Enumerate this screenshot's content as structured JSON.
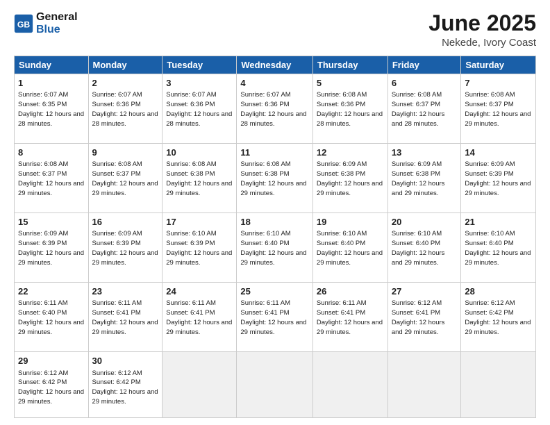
{
  "header": {
    "logo_line1": "General",
    "logo_line2": "Blue",
    "title": "June 2025",
    "subtitle": "Nekede, Ivory Coast"
  },
  "weekdays": [
    "Sunday",
    "Monday",
    "Tuesday",
    "Wednesday",
    "Thursday",
    "Friday",
    "Saturday"
  ],
  "weeks": [
    [
      {
        "day": "1",
        "sunrise": "6:07 AM",
        "sunset": "6:35 PM",
        "daylight": "12 hours and 28 minutes."
      },
      {
        "day": "2",
        "sunrise": "6:07 AM",
        "sunset": "6:36 PM",
        "daylight": "12 hours and 28 minutes."
      },
      {
        "day": "3",
        "sunrise": "6:07 AM",
        "sunset": "6:36 PM",
        "daylight": "12 hours and 28 minutes."
      },
      {
        "day": "4",
        "sunrise": "6:07 AM",
        "sunset": "6:36 PM",
        "daylight": "12 hours and 28 minutes."
      },
      {
        "day": "5",
        "sunrise": "6:08 AM",
        "sunset": "6:36 PM",
        "daylight": "12 hours and 28 minutes."
      },
      {
        "day": "6",
        "sunrise": "6:08 AM",
        "sunset": "6:37 PM",
        "daylight": "12 hours and 28 minutes."
      },
      {
        "day": "7",
        "sunrise": "6:08 AM",
        "sunset": "6:37 PM",
        "daylight": "12 hours and 29 minutes."
      }
    ],
    [
      {
        "day": "8",
        "sunrise": "6:08 AM",
        "sunset": "6:37 PM",
        "daylight": "12 hours and 29 minutes."
      },
      {
        "day": "9",
        "sunrise": "6:08 AM",
        "sunset": "6:37 PM",
        "daylight": "12 hours and 29 minutes."
      },
      {
        "day": "10",
        "sunrise": "6:08 AM",
        "sunset": "6:38 PM",
        "daylight": "12 hours and 29 minutes."
      },
      {
        "day": "11",
        "sunrise": "6:08 AM",
        "sunset": "6:38 PM",
        "daylight": "12 hours and 29 minutes."
      },
      {
        "day": "12",
        "sunrise": "6:09 AM",
        "sunset": "6:38 PM",
        "daylight": "12 hours and 29 minutes."
      },
      {
        "day": "13",
        "sunrise": "6:09 AM",
        "sunset": "6:38 PM",
        "daylight": "12 hours and 29 minutes."
      },
      {
        "day": "14",
        "sunrise": "6:09 AM",
        "sunset": "6:39 PM",
        "daylight": "12 hours and 29 minutes."
      }
    ],
    [
      {
        "day": "15",
        "sunrise": "6:09 AM",
        "sunset": "6:39 PM",
        "daylight": "12 hours and 29 minutes."
      },
      {
        "day": "16",
        "sunrise": "6:09 AM",
        "sunset": "6:39 PM",
        "daylight": "12 hours and 29 minutes."
      },
      {
        "day": "17",
        "sunrise": "6:10 AM",
        "sunset": "6:39 PM",
        "daylight": "12 hours and 29 minutes."
      },
      {
        "day": "18",
        "sunrise": "6:10 AM",
        "sunset": "6:40 PM",
        "daylight": "12 hours and 29 minutes."
      },
      {
        "day": "19",
        "sunrise": "6:10 AM",
        "sunset": "6:40 PM",
        "daylight": "12 hours and 29 minutes."
      },
      {
        "day": "20",
        "sunrise": "6:10 AM",
        "sunset": "6:40 PM",
        "daylight": "12 hours and 29 minutes."
      },
      {
        "day": "21",
        "sunrise": "6:10 AM",
        "sunset": "6:40 PM",
        "daylight": "12 hours and 29 minutes."
      }
    ],
    [
      {
        "day": "22",
        "sunrise": "6:11 AM",
        "sunset": "6:40 PM",
        "daylight": "12 hours and 29 minutes."
      },
      {
        "day": "23",
        "sunrise": "6:11 AM",
        "sunset": "6:41 PM",
        "daylight": "12 hours and 29 minutes."
      },
      {
        "day": "24",
        "sunrise": "6:11 AM",
        "sunset": "6:41 PM",
        "daylight": "12 hours and 29 minutes."
      },
      {
        "day": "25",
        "sunrise": "6:11 AM",
        "sunset": "6:41 PM",
        "daylight": "12 hours and 29 minutes."
      },
      {
        "day": "26",
        "sunrise": "6:11 AM",
        "sunset": "6:41 PM",
        "daylight": "12 hours and 29 minutes."
      },
      {
        "day": "27",
        "sunrise": "6:12 AM",
        "sunset": "6:41 PM",
        "daylight": "12 hours and 29 minutes."
      },
      {
        "day": "28",
        "sunrise": "6:12 AM",
        "sunset": "6:42 PM",
        "daylight": "12 hours and 29 minutes."
      }
    ],
    [
      {
        "day": "29",
        "sunrise": "6:12 AM",
        "sunset": "6:42 PM",
        "daylight": "12 hours and 29 minutes."
      },
      {
        "day": "30",
        "sunrise": "6:12 AM",
        "sunset": "6:42 PM",
        "daylight": "12 hours and 29 minutes."
      },
      null,
      null,
      null,
      null,
      null
    ]
  ],
  "labels": {
    "sunrise": "Sunrise:",
    "sunset": "Sunset:",
    "daylight": "Daylight:"
  }
}
